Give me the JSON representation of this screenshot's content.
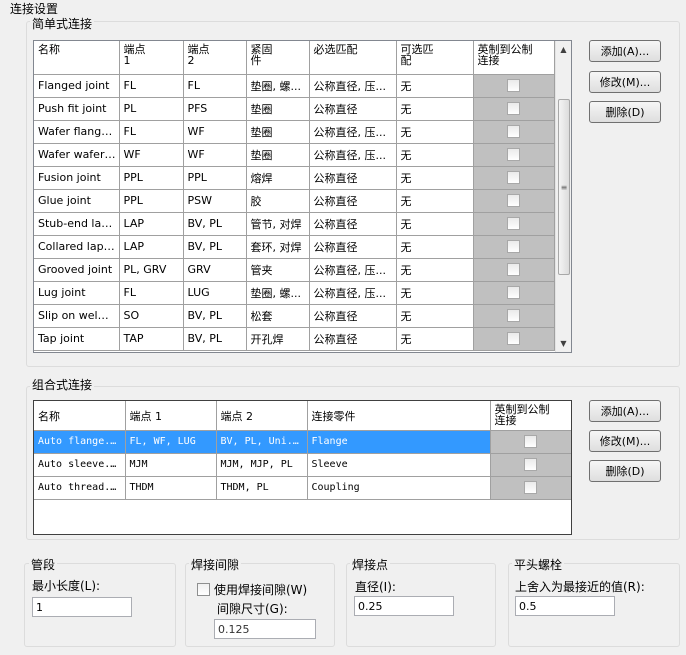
{
  "window_title": "连接设置",
  "simple": {
    "title": "简单式连接",
    "headers": [
      "名称",
      "端点\n1",
      "端点\n2",
      "紧固\n件",
      "必选匹配",
      "可选匹\n配",
      "英制到公制\n连接"
    ],
    "rows": [
      [
        "Flanged joint",
        "FL",
        "FL",
        "垫圈, 螺...",
        "公称直径, 压...",
        "无"
      ],
      [
        "Push fit joint",
        "PL",
        "PFS",
        "垫圈",
        "公称直径",
        "无"
      ],
      [
        "Wafer flanged...",
        "FL",
        "WF",
        "垫圈",
        "公称直径, 压...",
        "无"
      ],
      [
        "Wafer wafer j...",
        "WF",
        "WF",
        "垫圈",
        "公称直径, 压...",
        "无"
      ],
      [
        "Fusion joint",
        "PPL",
        "PPL",
        "熔焊",
        "公称直径",
        "无"
      ],
      [
        "Glue joint",
        "PPL",
        "PSW",
        "胶",
        "公称直径",
        "无"
      ],
      [
        "Stub-end lapp...",
        "LAP",
        "BV, PL",
        "管节, 对焊",
        "公称直径",
        "无"
      ],
      [
        "Collared lappe...",
        "LAP",
        "BV, PL",
        "套环, 对焊",
        "公称直径",
        "无"
      ],
      [
        "Grooved joint",
        "PL, GRV",
        "GRV",
        "管夹",
        "公称直径, 压...",
        "无"
      ],
      [
        "Lug joint",
        "FL",
        "LUG",
        "垫圈, 螺...",
        "公称直径, 压...",
        "无"
      ],
      [
        "Slip on weld jo...",
        "SO",
        "BV, PL",
        "松套",
        "公称直径",
        "无"
      ],
      [
        "Tap joint",
        "TAP",
        "BV, PL",
        "开孔焊",
        "公称直径",
        "无"
      ]
    ],
    "buttons": {
      "add": "添加(A)...",
      "edit": "修改(M)...",
      "delete": "删除(D)"
    }
  },
  "compound": {
    "title": "组合式连接",
    "headers": [
      "名称",
      "端点 1",
      "端点 2",
      "连接零件",
      "英制到公制\n连接"
    ],
    "rows": [
      [
        "Auto flange...",
        "FL, WF, LUG",
        "BV, PL, Uni...",
        "Flange"
      ],
      [
        "Auto sleeve...",
        "MJM",
        "MJM, MJP, PL",
        "Sleeve"
      ],
      [
        "Auto thread...",
        "THDM",
        "THDM, PL",
        "Coupling"
      ]
    ],
    "buttons": {
      "add": "添加(A)...",
      "edit": "修改(M)...",
      "delete": "删除(D)"
    }
  },
  "pipe_segment": {
    "title": "管段",
    "label": "最小长度(L):",
    "value": "1"
  },
  "weld_gap": {
    "title": "焊接间隙",
    "checkbox_label": "使用焊接间隙(W)",
    "gap_label": "间隙尺寸(G):",
    "value": "0.125"
  },
  "weld_point": {
    "title": "焊接点",
    "label": "直径(I):",
    "value": "0.25"
  },
  "flat_bolt": {
    "title": "平头螺栓",
    "label": "上舍入为最接近的值(R):",
    "value": "0.5"
  }
}
